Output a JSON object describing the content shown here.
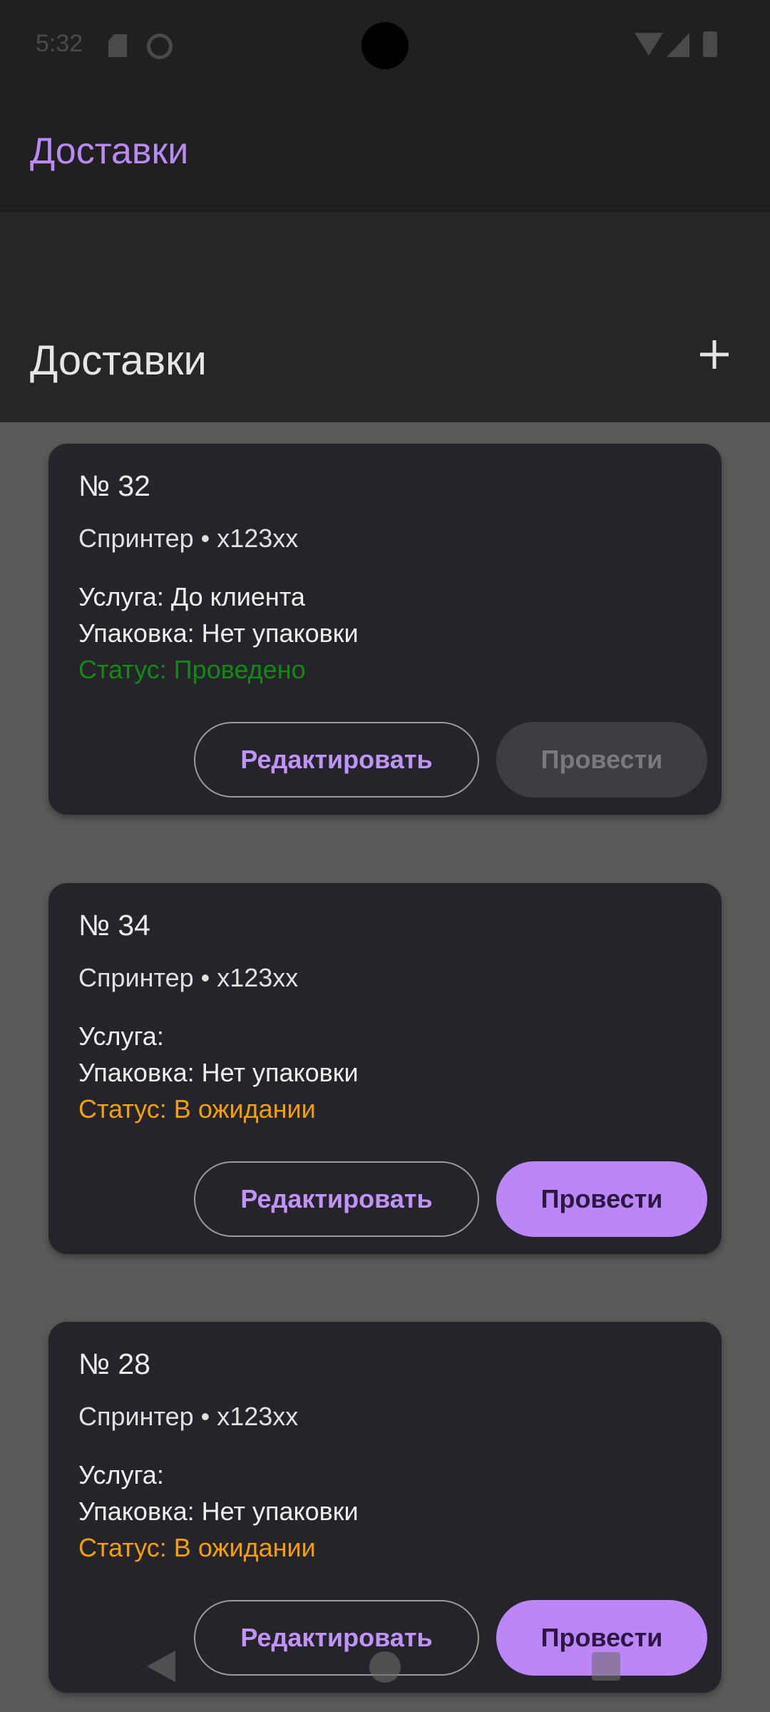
{
  "status_bar": {
    "time": "5:32",
    "icons": [
      "sd-card-icon",
      "circle-icon",
      "wifi-icon",
      "signal-icon",
      "battery-icon"
    ]
  },
  "app_bar": {
    "title": "Доставки"
  },
  "section": {
    "title": "Доставки",
    "add_icon": "plus-icon"
  },
  "cards": [
    {
      "number": "№ 32",
      "vehicle": "Спринтер • х123хх",
      "service": "Услуга: До клиента",
      "packaging": "Упаковка: Нет упаковки",
      "status": "Статус: Проведено",
      "status_color": "#138a13",
      "edit_label": "Редактировать",
      "run_label": "Провести",
      "run_enabled": false
    },
    {
      "number": "№ 34",
      "vehicle": "Спринтер • х123хх",
      "service": "Услуга:",
      "packaging": "Упаковка: Нет упаковки",
      "status": "Статус: В ожидании",
      "status_color": "#f4a000",
      "edit_label": "Редактировать",
      "run_label": "Провести",
      "run_enabled": true
    },
    {
      "number": "№ 28",
      "vehicle": "Спринтер • х123хх",
      "service": "Услуга:",
      "packaging": "Упаковка: Нет упаковки",
      "status": "Статус: В ожидании",
      "status_color": "#f4a000",
      "edit_label": "Редактировать",
      "run_label": "Провести",
      "run_enabled": true
    }
  ],
  "colors": {
    "accent": "#bd86f6",
    "background": "#5a5a5a",
    "card": "#25242a",
    "status_done": "#138a13",
    "status_waiting": "#f4a000"
  }
}
